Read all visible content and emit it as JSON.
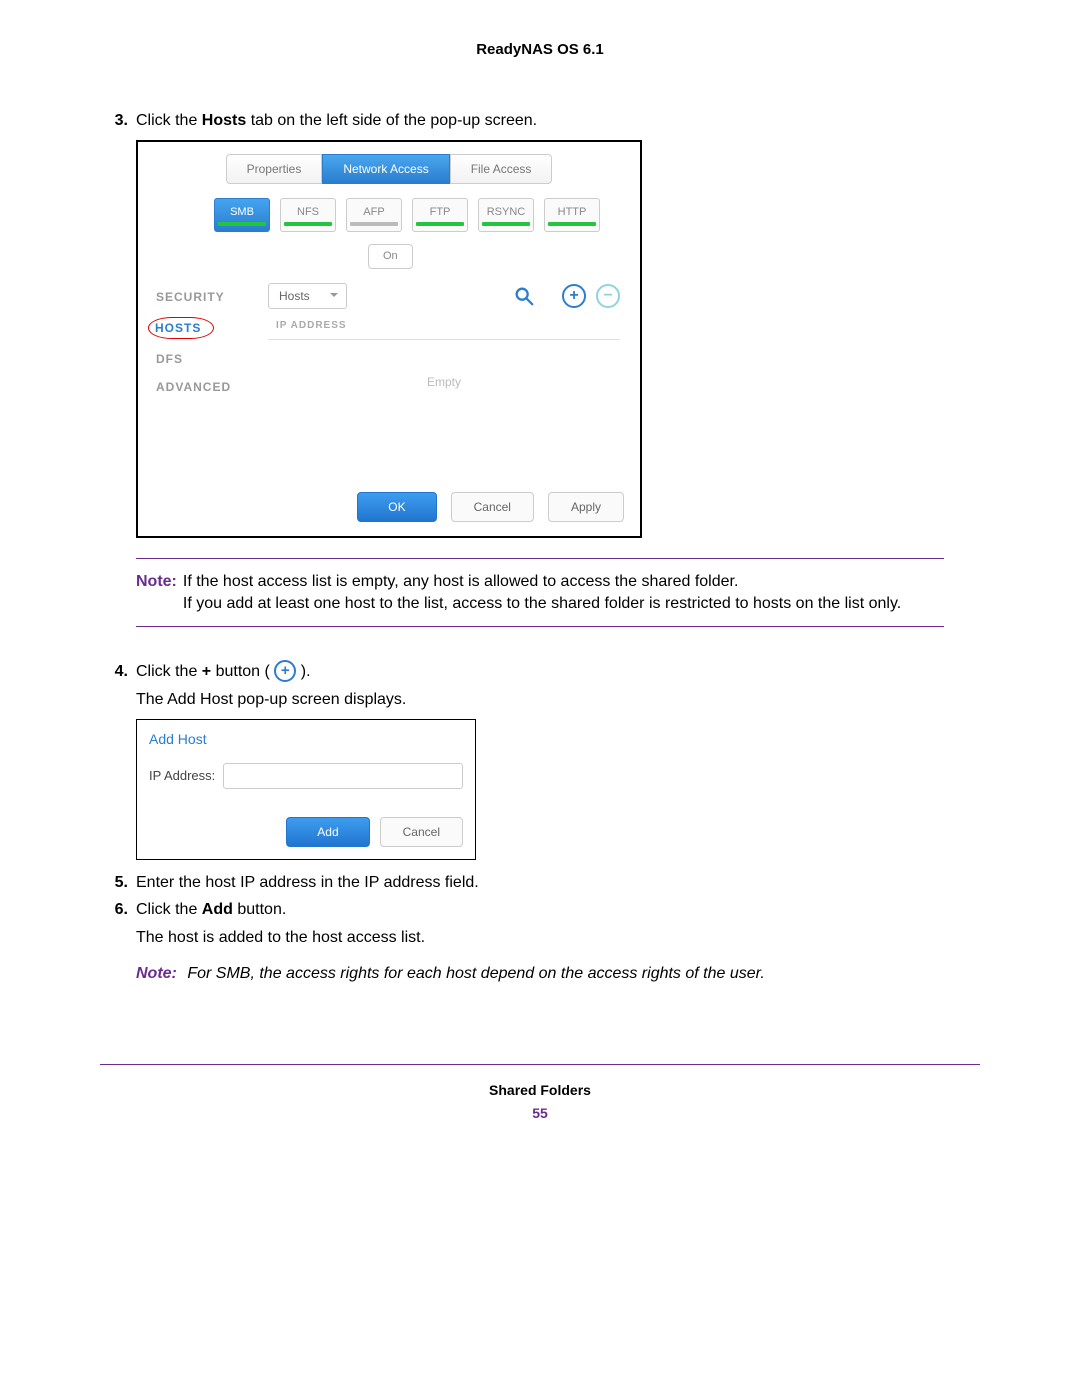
{
  "doc_header": "ReadyNAS OS 6.1",
  "step3": {
    "num": "3.",
    "prefix": "Click the ",
    "bold": "Hosts",
    "suffix": " tab on the left side of the pop-up screen."
  },
  "popup1": {
    "tabs": {
      "properties": "Properties",
      "network": "Network Access",
      "file": "File Access"
    },
    "protocols": {
      "smb": "SMB",
      "nfs": "NFS",
      "afp": "AFP",
      "ftp": "FTP",
      "rsync": "RSYNC",
      "http": "HTTP"
    },
    "on": "On",
    "sidebar": {
      "security": "SECURITY",
      "hosts": "HOSTS",
      "dfs": "DFS",
      "advanced": "ADVANCED"
    },
    "hosts_select": "Hosts",
    "ip_header": "IP ADDRESS",
    "empty": "Empty",
    "buttons": {
      "ok": "OK",
      "cancel": "Cancel",
      "apply": "Apply"
    }
  },
  "note1": {
    "label": "Note:",
    "line1": "If the host access list is empty, any host is allowed to access the shared folder.",
    "line2": "If you add at least one host to the list, access to the shared folder is restricted to hosts on the list only."
  },
  "step4": {
    "num": "4.",
    "prefix": "Click the ",
    "bold": "+",
    "mid": " button ( ",
    "suffix": " ).",
    "sub": "The Add Host pop-up screen displays."
  },
  "addhost": {
    "title": "Add Host",
    "label": "IP Address:",
    "add": "Add",
    "cancel": "Cancel"
  },
  "step5": {
    "num": "5.",
    "text": "Enter the host IP address in the IP address field."
  },
  "step6": {
    "num": "6.",
    "prefix": "Click the ",
    "bold": "Add",
    "suffix": " button.",
    "sub": "The host is added to the host access list."
  },
  "note2": {
    "label": "Note:",
    "text": "For SMB, the access rights for each host depend on the access rights of the user."
  },
  "footer": {
    "section": "Shared Folders",
    "page": "55"
  }
}
